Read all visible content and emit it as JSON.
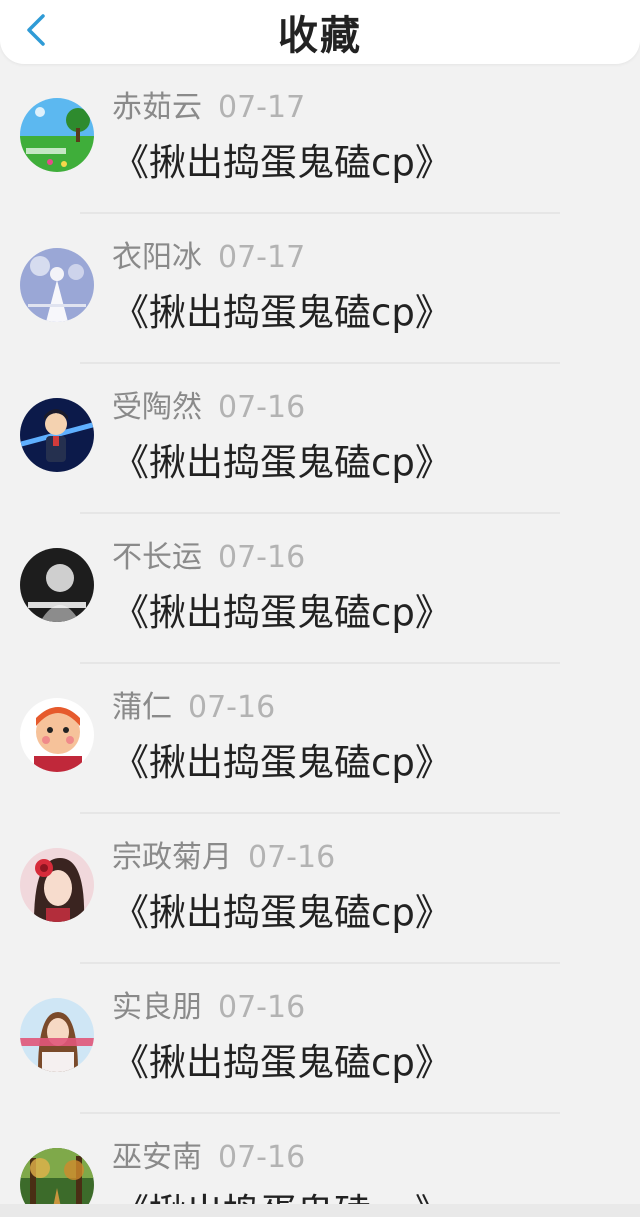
{
  "header": {
    "back_icon": "chevron-left-icon",
    "title": "收藏",
    "accent": "#2f9bd6"
  },
  "favorites": [
    {
      "name": "赤茹云",
      "date": "07-17",
      "title": "《揪出捣蛋鬼磕cp》",
      "avatar": "landscape"
    },
    {
      "name": "衣阳冰",
      "date": "07-17",
      "title": "《揪出捣蛋鬼磕cp》",
      "avatar": "figure-white"
    },
    {
      "name": "受陶然",
      "date": "07-16",
      "title": "《揪出捣蛋鬼磕cp》",
      "avatar": "anime-boy"
    },
    {
      "name": "不长运",
      "date": "07-16",
      "title": "《揪出捣蛋鬼磕cp》",
      "avatar": "mono-photo"
    },
    {
      "name": "蒲仁",
      "date": "07-16",
      "title": "《揪出捣蛋鬼磕cp》",
      "avatar": "cartoon"
    },
    {
      "name": "宗政菊月",
      "date": "07-16",
      "title": "《揪出捣蛋鬼磕cp》",
      "avatar": "girl-flower"
    },
    {
      "name": "实良朋",
      "date": "07-16",
      "title": "《揪出捣蛋鬼磕cp》",
      "avatar": "girl-photo"
    },
    {
      "name": "巫安南",
      "date": "07-16",
      "title": "《揪出捣蛋鬼磕cp》",
      "avatar": "forest"
    }
  ]
}
